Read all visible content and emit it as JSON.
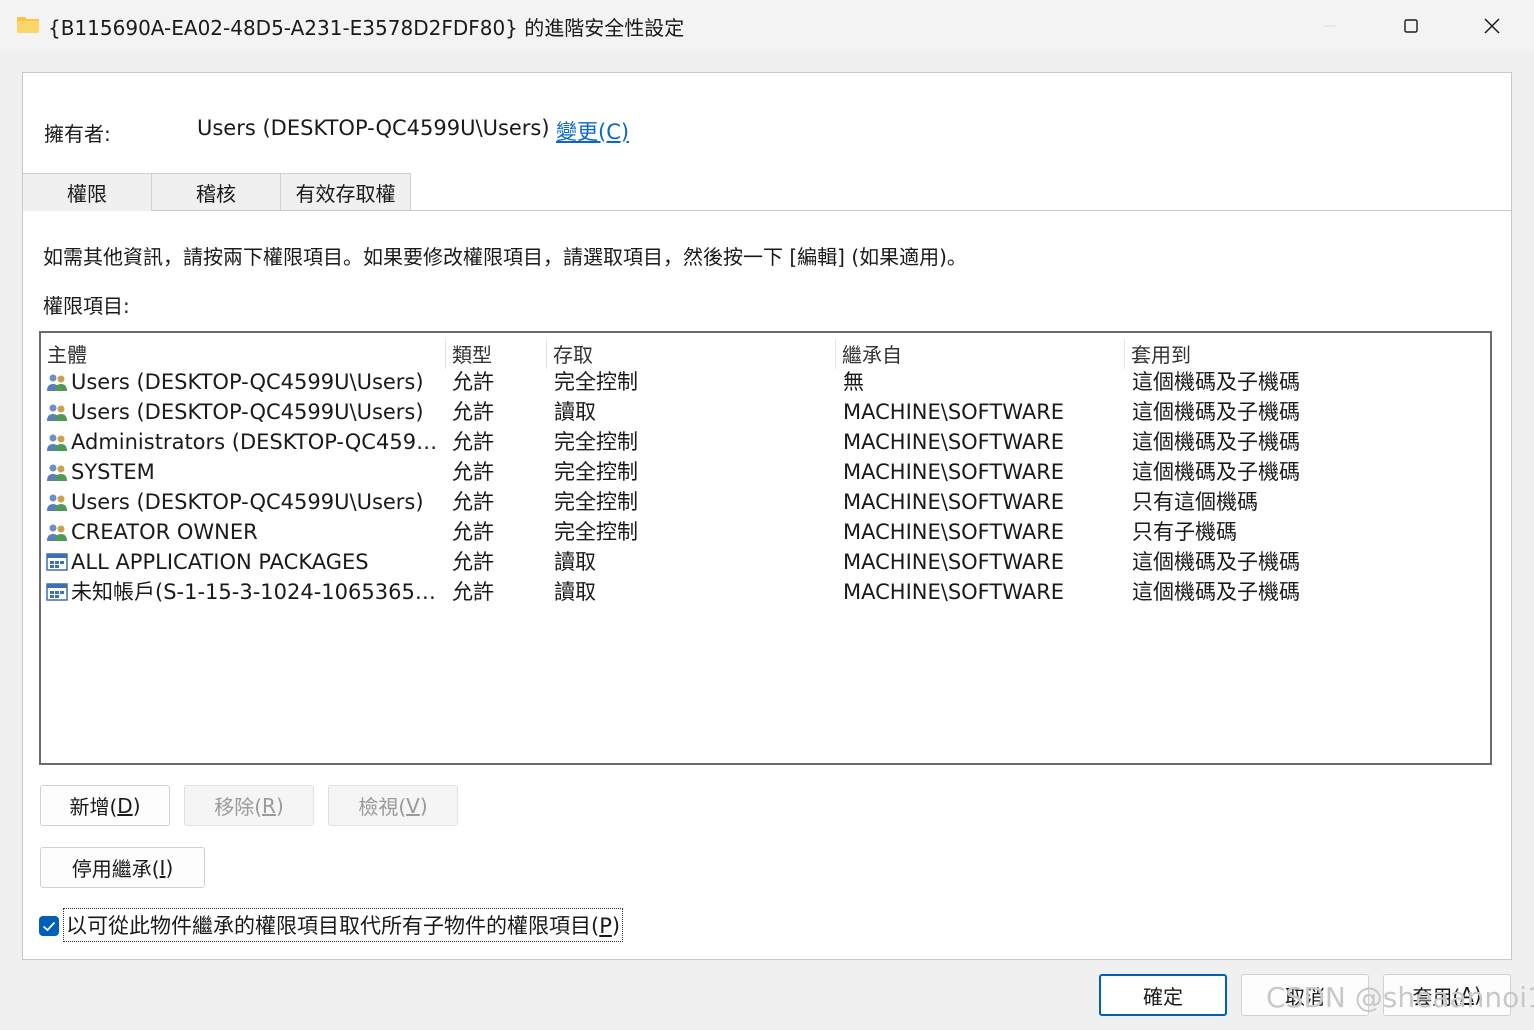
{
  "window": {
    "title": "{B115690A-EA02-48D5-A231-E3578D2FDF80} 的進階安全性設定"
  },
  "owner": {
    "label": "擁有者:",
    "value": "Users (DESKTOP-QC4599U\\Users)",
    "change_link": "變更(C)"
  },
  "tabs": [
    {
      "label": "權限"
    },
    {
      "label": "稽核"
    },
    {
      "label": "有效存取權"
    }
  ],
  "info_text": "如需其他資訊，請按兩下權限項目。如果要修改權限項目，請選取項目，然後按一下 [編輯] (如果適用)。",
  "entries_label": "權限項目:",
  "table": {
    "headers": [
      "主體",
      "類型",
      "存取",
      "繼承自",
      "套用到"
    ],
    "rows": [
      {
        "icon": "users-group-icon",
        "principal": "Users (DESKTOP-QC4599U\\Users)",
        "type": "允許",
        "access": "完全控制",
        "inherited": "無",
        "applies": "這個機碼及子機碼"
      },
      {
        "icon": "users-group-icon",
        "principal": "Users (DESKTOP-QC4599U\\Users)",
        "type": "允許",
        "access": "讀取",
        "inherited": "MACHINE\\SOFTWARE",
        "applies": "這個機碼及子機碼"
      },
      {
        "icon": "users-group-icon",
        "principal": "Administrators (DESKTOP-QC4599U...",
        "type": "允許",
        "access": "完全控制",
        "inherited": "MACHINE\\SOFTWARE",
        "applies": "這個機碼及子機碼"
      },
      {
        "icon": "users-group-icon",
        "principal": "SYSTEM",
        "type": "允許",
        "access": "完全控制",
        "inherited": "MACHINE\\SOFTWARE",
        "applies": "這個機碼及子機碼"
      },
      {
        "icon": "users-group-icon",
        "principal": "Users (DESKTOP-QC4599U\\Users)",
        "type": "允許",
        "access": "完全控制",
        "inherited": "MACHINE\\SOFTWARE",
        "applies": "只有這個機碼"
      },
      {
        "icon": "users-group-icon",
        "principal": "CREATOR OWNER",
        "type": "允許",
        "access": "完全控制",
        "inherited": "MACHINE\\SOFTWARE",
        "applies": "只有子機碼"
      },
      {
        "icon": "app-package-icon",
        "principal": "ALL APPLICATION PACKAGES",
        "type": "允許",
        "access": "讀取",
        "inherited": "MACHINE\\SOFTWARE",
        "applies": "這個機碼及子機碼"
      },
      {
        "icon": "app-package-icon",
        "principal": "未知帳戶(S-1-15-3-1024-106536593...",
        "type": "允許",
        "access": "讀取",
        "inherited": "MACHINE\\SOFTWARE",
        "applies": "這個機碼及子機碼"
      }
    ]
  },
  "buttons": {
    "add": {
      "text": "新增(",
      "key": "D",
      "end": ")"
    },
    "remove": {
      "text": "移除(",
      "key": "R",
      "end": ")"
    },
    "view": {
      "text": "檢視(",
      "key": "V",
      "end": ")"
    },
    "disable_inherit": {
      "text": "停用繼承(",
      "key": "I",
      "end": ")"
    },
    "ok": "確定",
    "cancel": "取消",
    "apply": {
      "text": "套用(",
      "key": "A",
      "end": ")"
    }
  },
  "replace_checkbox": {
    "checked": true,
    "text": "以可從此物件繼承的權限項目取代所有子物件的權限項目(",
    "key": "P",
    "end": ")"
  },
  "watermark": "CSDN @sheaannoi1",
  "colors": {
    "accent": "#005fb8",
    "link": "#0a66c8"
  }
}
